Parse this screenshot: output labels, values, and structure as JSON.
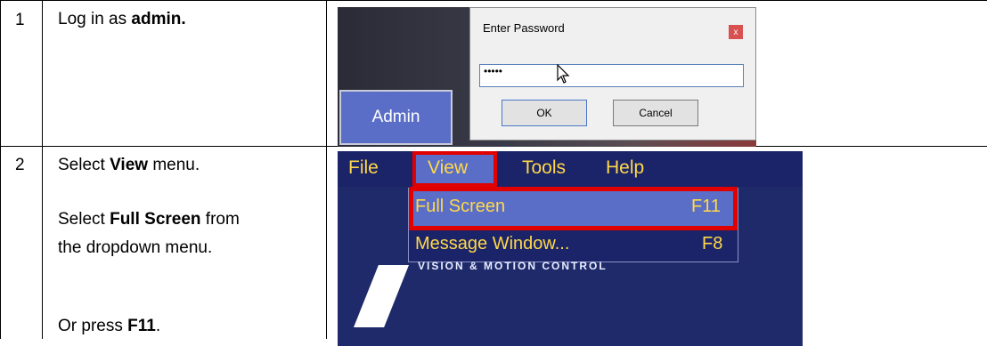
{
  "rows": [
    {
      "number": "1",
      "text": {
        "pre": "Log in as ",
        "bold": "admin.",
        "post": ""
      }
    },
    {
      "number": "2",
      "lines": [
        {
          "pre": "Select ",
          "bold": "View",
          "post": " menu."
        },
        {
          "pre": "Select ",
          "bold": "Full Screen",
          "post": " from"
        },
        {
          "pre": "the dropdown menu.",
          "bold": "",
          "post": ""
        },
        {
          "pre": "Or press ",
          "bold": "F11",
          "post": "."
        }
      ]
    }
  ],
  "login_screenshot": {
    "admin_button": "Admin",
    "dialog_title": "Enter Password",
    "close_glyph": "x",
    "password_value": "•••••",
    "ok_label": "OK",
    "cancel_label": "Cancel"
  },
  "menu_screenshot": {
    "menus": [
      "File",
      "View",
      "Tools",
      "Help"
    ],
    "dropdown": [
      {
        "label": "Full Screen",
        "shortcut": "F11"
      },
      {
        "label": "Message Window...",
        "shortcut": "F8"
      }
    ],
    "logo_text": "VISION & MOTION CONTROL"
  },
  "colors": {
    "highlight": "#e00000",
    "menu_text": "#ffd84a",
    "menu_bg": "#1b2468",
    "selected_bg": "#5a6ec8"
  }
}
